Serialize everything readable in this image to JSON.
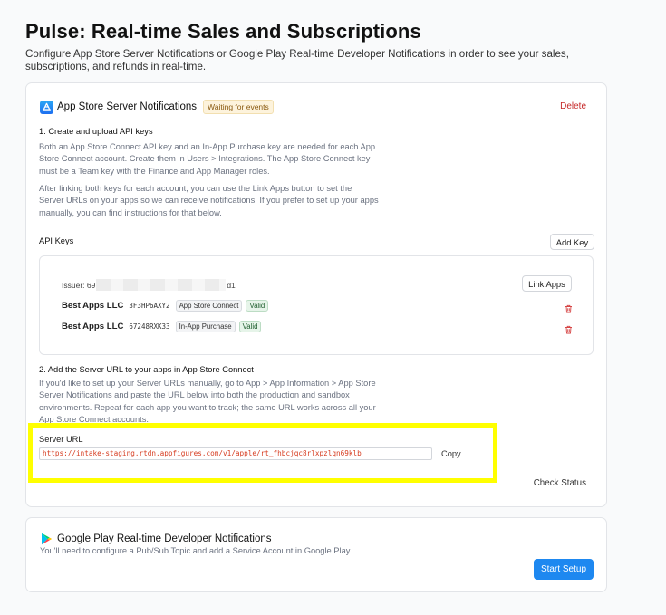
{
  "page": {
    "title": "Pulse: Real-time Sales and Subscriptions",
    "subtitle": "Configure App Store Server Notifications or Google Play Real-time Developer Notifications in order to see your sales, subscriptions, and refunds in real-time."
  },
  "app_store": {
    "title": "App Store Server Notifications",
    "status_badge": "Waiting for events",
    "delete_label": "Delete",
    "step1_heading": "1. Create and upload API keys",
    "step1_para1": "Both an App Store Connect API key and an In-App Purchase key are needed for each App Store Connect account. Create them in Users > Integrations. The App Store Connect key must be a Team key with the Finance and App Manager roles.",
    "step1_para2": "After linking both keys for each account, you can use the Link Apps button to set the Server URLs on your apps so we can receive notifications. If you prefer to set up your apps manually, you can find instructions for that below.",
    "api_keys_label": "API Keys",
    "add_key_label": "Add Key",
    "issuer_prefix": "Issuer: 69",
    "issuer_suffix": "d1",
    "link_apps_label": "Link Apps",
    "keys": [
      {
        "name": "Best Apps LLC",
        "key_id": "3F3HP6AXY2",
        "type": "App Store Connect",
        "status": "Valid"
      },
      {
        "name": "Best Apps LLC",
        "key_id": "67248RXK33",
        "type": "In-App Purchase",
        "status": "Valid"
      }
    ],
    "step2_heading": "2. Add the Server URL to your apps in App Store Connect",
    "step2_para": "If you'd like to set up your Server URLs manually, go to App > App Information > App Store Server Notifications and paste the URL below into both the production and sandbox environments. Repeat for each app you want to track; the same URL works across all your App Store Connect accounts.",
    "server_url_label": "Server URL",
    "server_url": "https://intake-staging.rtdn.appfigures.com/v1/apple/rt_fhbcjqc8rlxpzlqn69klb",
    "copy_label": "Copy",
    "check_status_label": "Check Status"
  },
  "google_play": {
    "title": "Google Play Real-time Developer Notifications",
    "subtitle": "You'll need to configure a Pub/Sub Topic and add a Service Account in Google Play.",
    "start_setup_label": "Start Setup"
  },
  "colors": {
    "accent": "#1e88f0",
    "danger": "#c62828",
    "highlight": "#ffff00",
    "valid": "#1f5e2e"
  }
}
